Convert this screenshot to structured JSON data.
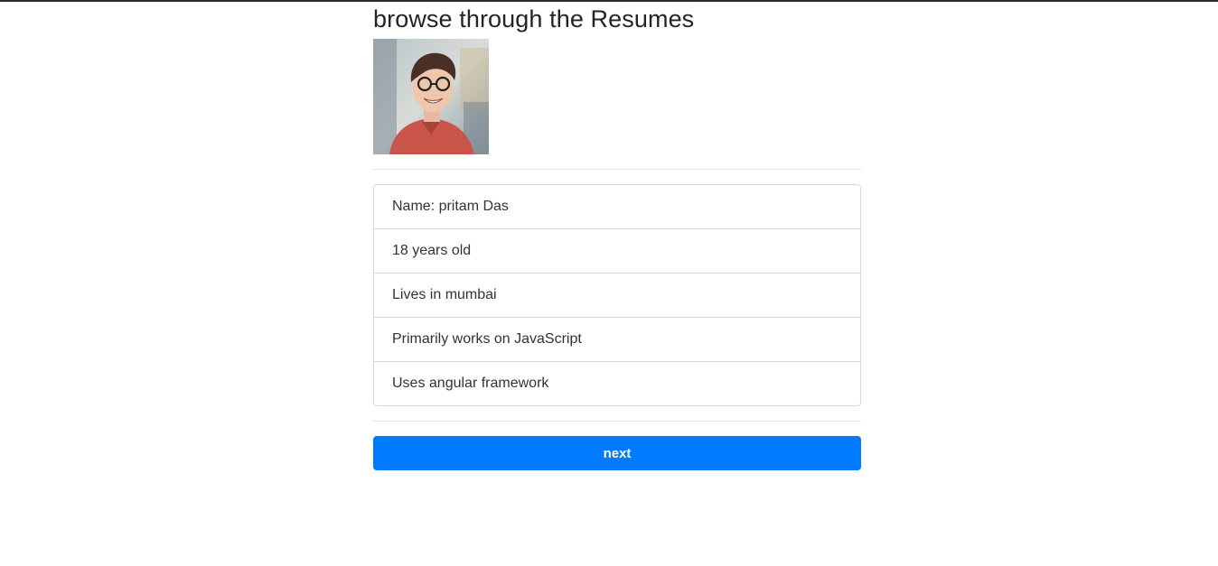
{
  "page": {
    "title": "browse through the Resumes"
  },
  "profile": {
    "photo_icon": "avatar-photo",
    "details": [
      "Name: pritam Das",
      "18 years old",
      "Lives in mumbai",
      "Primarily works on JavaScript",
      "Uses angular framework"
    ]
  },
  "actions": {
    "next_label": "next"
  },
  "colors": {
    "primary": "#007bff",
    "text": "#212529",
    "border": "#d9d9d9"
  }
}
